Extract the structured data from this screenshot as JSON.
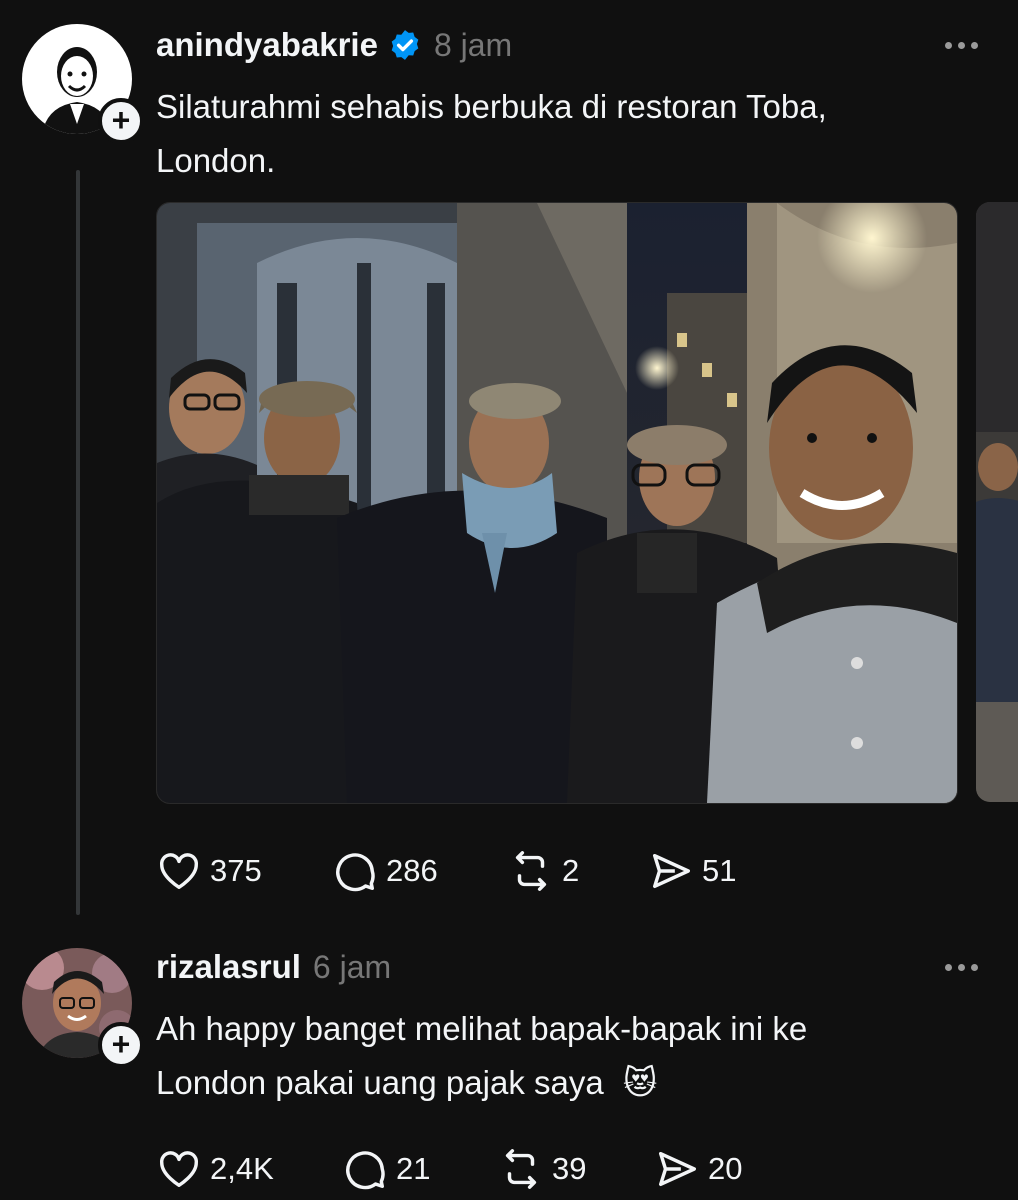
{
  "post": {
    "username": "anindyabakrie",
    "time": "8 jam",
    "text_line1": "Silaturahmi sehabis berbuka di restoran Toba,",
    "text_line2": "London.",
    "likes": "375",
    "comments": "286",
    "reposts": "2",
    "shares": "51"
  },
  "reply": {
    "username": "rizalasrul",
    "time": "6 jam",
    "text_line1": "Ah happy banget melihat bapak-bapak ini ke",
    "text_line2": "London pakai uang pajak saya",
    "emoji": "😻",
    "likes": "2,4K",
    "comments": "21",
    "reposts": "39",
    "shares": "20"
  },
  "icons": {
    "verified": "verified-badge-icon",
    "more": "more-options-icon",
    "like": "heart-icon",
    "comment": "comment-icon",
    "repost": "repost-icon",
    "share": "send-icon",
    "follow": "plus-icon"
  },
  "colors": {
    "background": "#101010",
    "text": "#f3f5f7",
    "muted": "#777777",
    "verified": "#0095f6"
  }
}
